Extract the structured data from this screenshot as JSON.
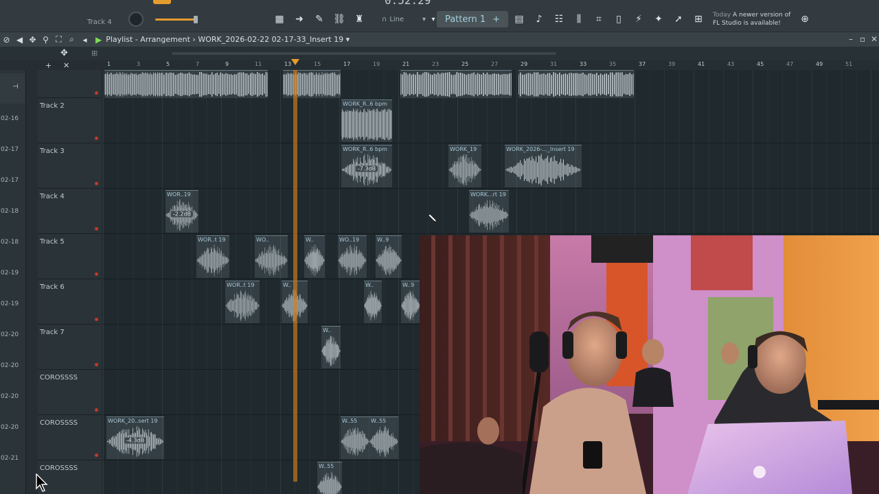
{
  "toolbar": {
    "track_label": "Track 4",
    "time": "0:52:29",
    "snap": "Line",
    "pattern": "Pattern 1",
    "news_date": "Today",
    "news_text": "A newer version of FL Studio is available!"
  },
  "playlist": {
    "title": "Playlist - Arrangement",
    "breadcrumb": "WORK_2026-02-22 02-17-33_Insert 19"
  },
  "ruler": {
    "bars": [
      "1",
      "3",
      "5",
      "7",
      "9",
      "11",
      "13",
      "15",
      "17",
      "19",
      "21",
      "23",
      "25",
      "27",
      "29",
      "31",
      "33",
      "35",
      "37",
      "39",
      "41",
      "43",
      "45",
      "47",
      "49",
      "51"
    ]
  },
  "browser_items": [
    "02-16",
    "02-17",
    "02-17",
    "02-18",
    "02-18",
    "02-19",
    "02-19",
    "02-20",
    "02-20",
    "02-20",
    "02-20",
    "02-21"
  ],
  "tracks": [
    {
      "name": "Track 2"
    },
    {
      "name": "Track 3"
    },
    {
      "name": "Track 4"
    },
    {
      "name": "Track 5"
    },
    {
      "name": "Track 6"
    },
    {
      "name": "Track 7"
    },
    {
      "name": "COROSSSS"
    },
    {
      "name": "COROSSSS"
    },
    {
      "name": "COROSSSS"
    }
  ],
  "clips": {
    "t2_a": "WORK_R..6 bpm",
    "t3_a": "WORK_R..6 bpm",
    "t3_a_gain": "-7.3dB",
    "t3_b": "WORK_19",
    "t3_c": "WORK_2026-..._Insert 19",
    "t4_a": "WOR..19",
    "t4_a_gain": "-2.2dB",
    "t4_b": "WORK...rt 19",
    "t5_a": "WOR..t 19",
    "t5_b": "WO..",
    "t5_c": "W..",
    "t5_d": "WO..19",
    "t5_e": "W..9",
    "t6_a": "WOR..t 19",
    "t6_b": "W..",
    "t6_c": "W..",
    "t6_d": "W..9",
    "t7_a": "W..",
    "c2_a": "WORK_20..sert 19",
    "c2_a_gain": "-4.3dB",
    "c2_b": "W..55",
    "c2_c": "W..55",
    "c3_a": "W..55"
  },
  "colors": {
    "accent": "#e59c2e",
    "playhead": "#d47f18",
    "background": "#1f292e"
  }
}
